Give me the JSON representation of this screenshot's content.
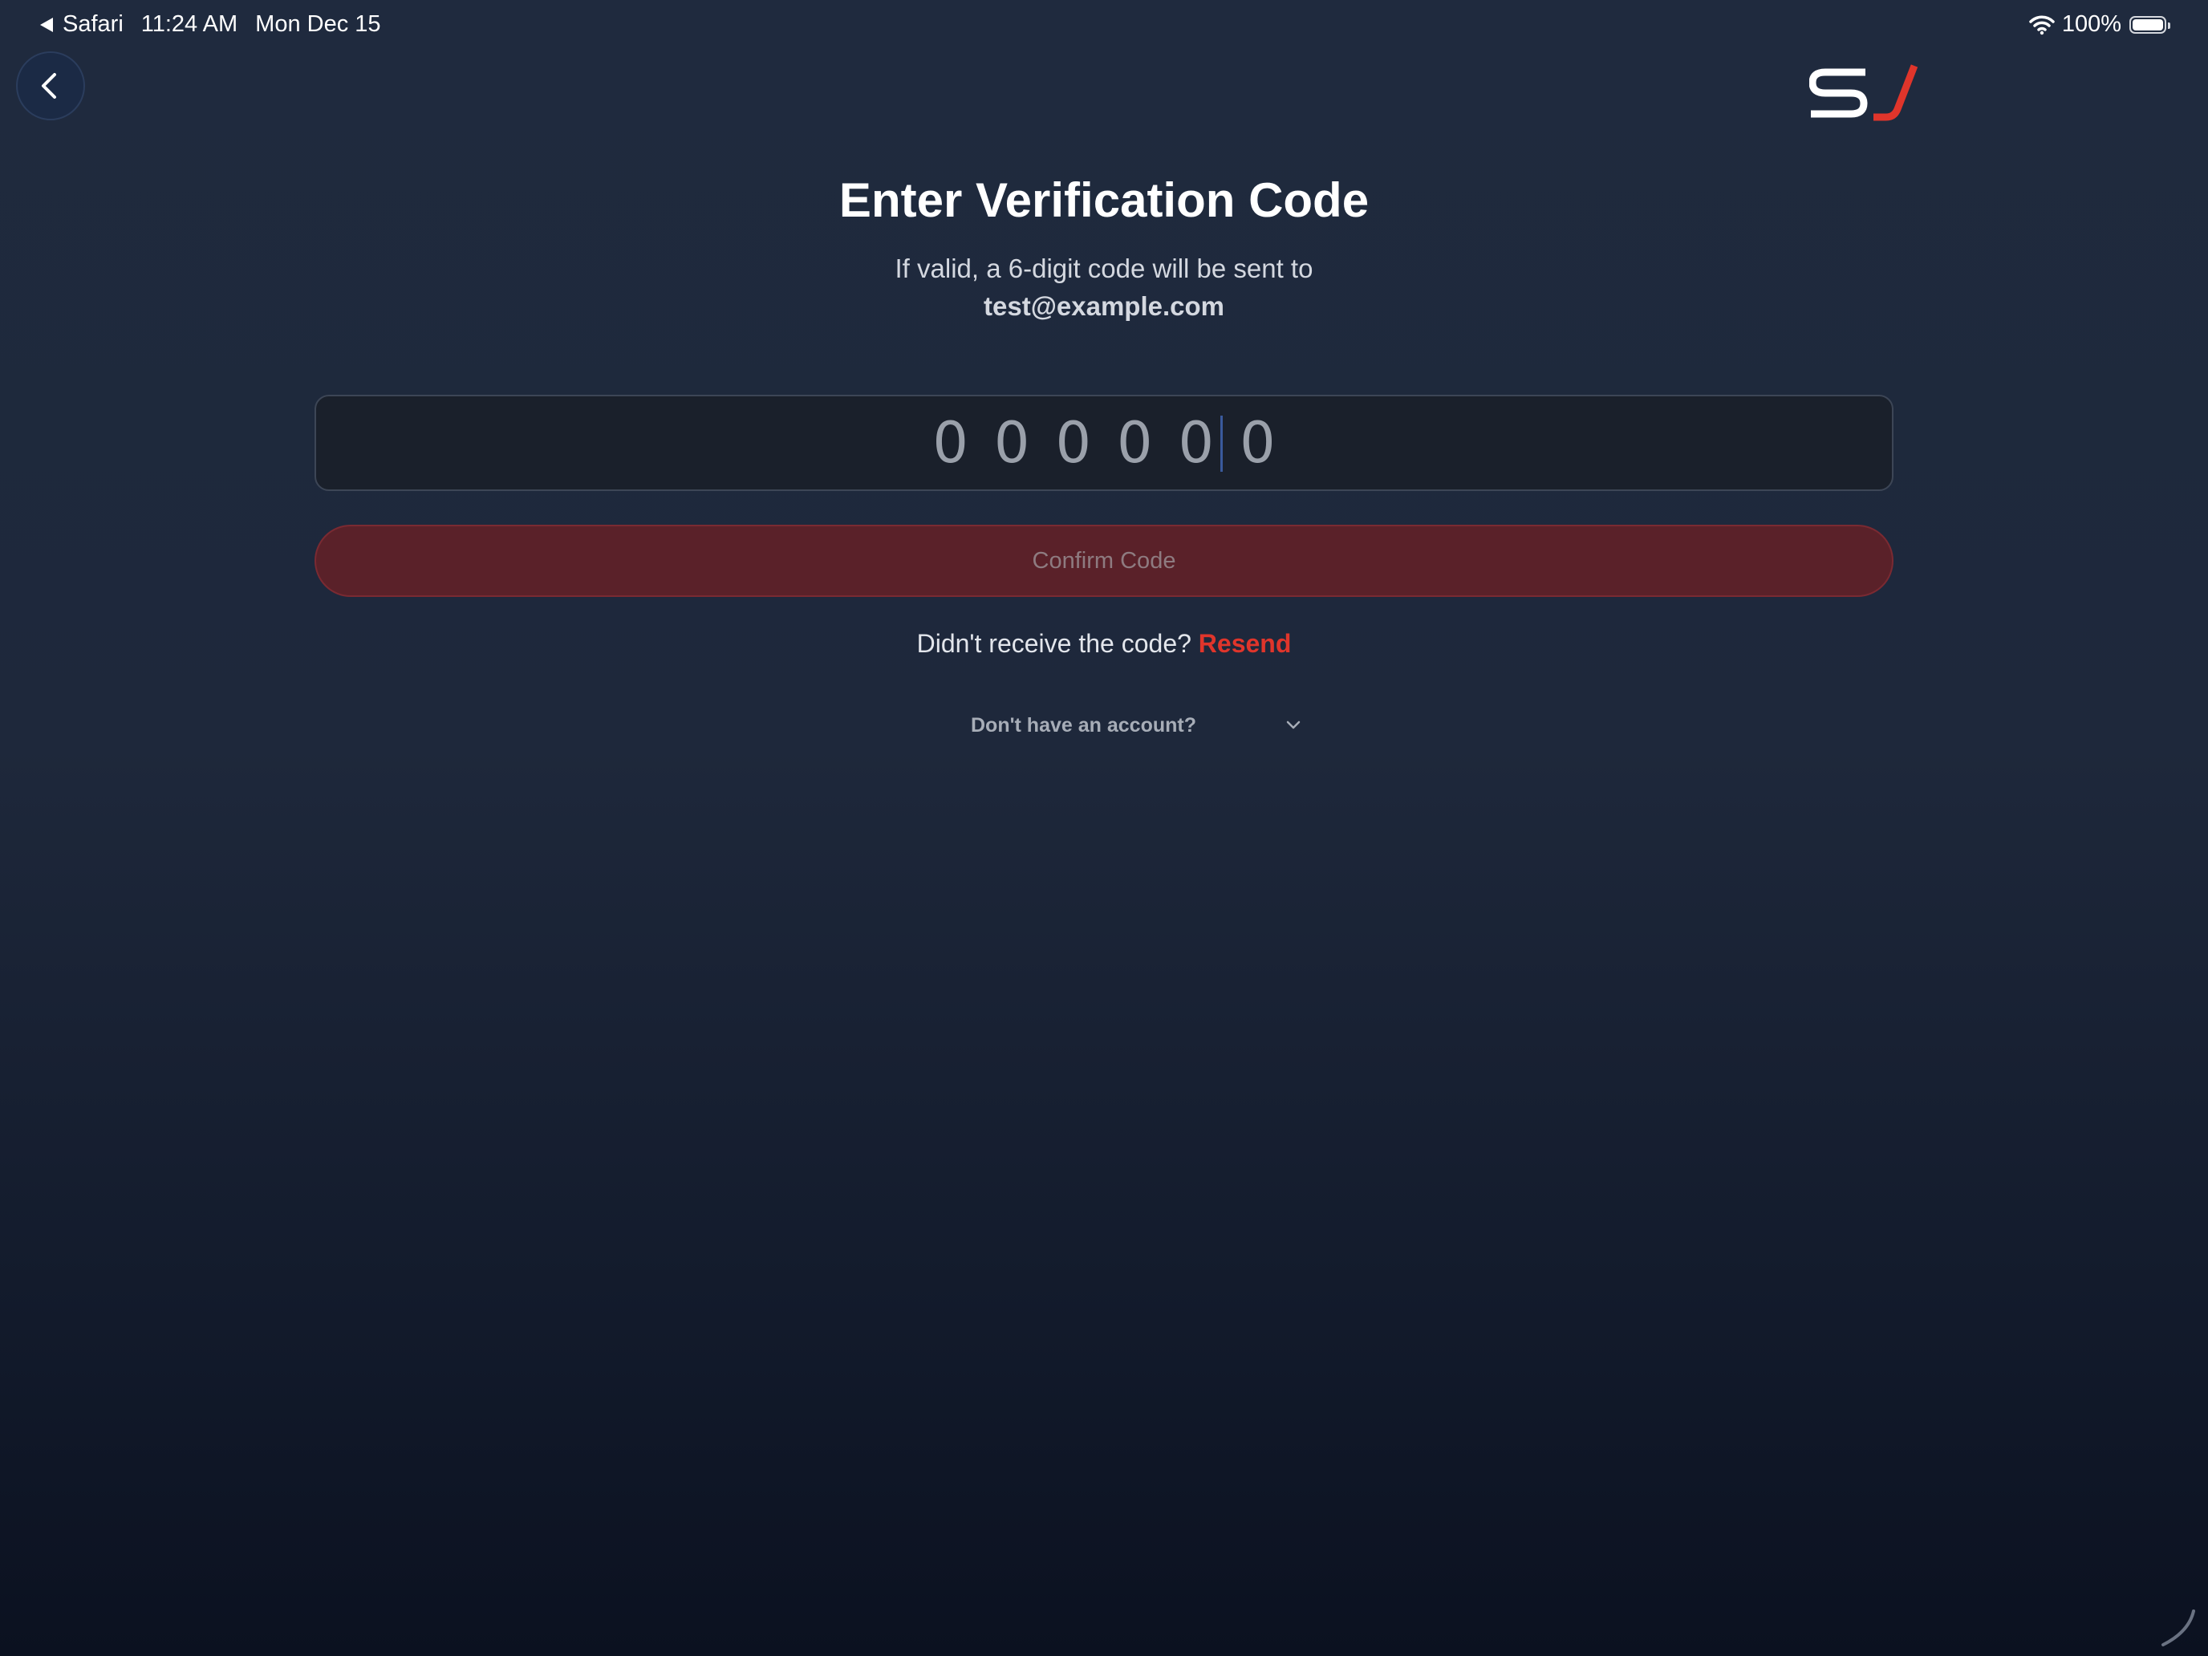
{
  "status_bar": {
    "back_app": "Safari",
    "time": "11:24 AM",
    "date": "Mon Dec 15",
    "battery": "100%"
  },
  "logo": {
    "letters": "SJ",
    "colors": {
      "s": "#ffffff",
      "j": "#e0352b"
    }
  },
  "title": "Enter Verification Code",
  "subtitle": "If valid, a 6-digit code will be sent to",
  "email": "test@example.com",
  "code_input": {
    "placeholder": "000000",
    "value": ""
  },
  "confirm_button": {
    "label": "Confirm Code"
  },
  "resend": {
    "prompt": "Didn't receive the code?",
    "link": "Resend"
  },
  "account_toggle": {
    "label": "Don't have an account?"
  },
  "colors": {
    "accent": "#e0352b",
    "background_top": "#1f2a3e",
    "background_bottom": "#0b1120",
    "confirm_disabled_bg": "#5a2129"
  }
}
